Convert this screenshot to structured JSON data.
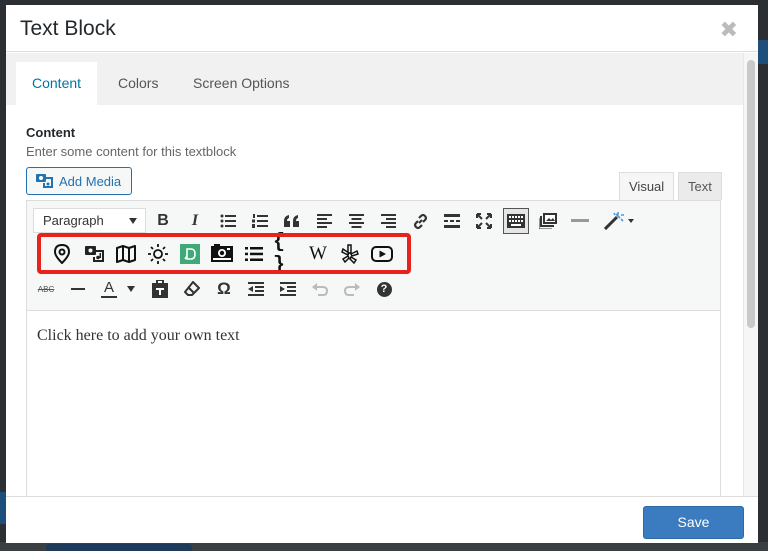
{
  "modal": {
    "title": "Text Block",
    "close_glyph": "✖"
  },
  "tabs": [
    {
      "label": "Content",
      "active": true
    },
    {
      "label": "Colors",
      "active": false
    },
    {
      "label": "Screen Options",
      "active": false
    }
  ],
  "content": {
    "label": "Content",
    "description": "Enter some content for this textblock"
  },
  "add_media": {
    "label": "Add Media",
    "icon": "media-icon"
  },
  "editor_modes": {
    "visual": "Visual",
    "text": "Text"
  },
  "toolbar": {
    "format_value": "Paragraph",
    "row1_icons": [
      "bold-icon",
      "italic-icon",
      "bullet-list-icon",
      "numbered-list-icon",
      "blockquote-icon",
      "align-left-icon",
      "align-center-icon",
      "align-right-icon",
      "link-icon",
      "read-more-icon",
      "fullscreen-icon",
      "toolbar-toggle-icon",
      "gallery-icon",
      "horizontal-rule-icon",
      "magic-wand-icon"
    ],
    "row1_text": {
      "bold": "B",
      "italic": "I"
    },
    "plugin_icons": [
      "map-pin-icon",
      "media-icon",
      "map-icon",
      "sun-icon",
      "plugin-d-icon",
      "photo-gallery-icon",
      "list-icon",
      "code-braces-icon",
      "wikipedia-icon",
      "yelp-icon",
      "youtube-icon"
    ],
    "plugin_text": {
      "braces": "{ }",
      "wiki": "W"
    },
    "row3_icons": [
      "strikethrough-icon",
      "horizontal-line-icon",
      "text-color-icon",
      "paste-text-icon",
      "clear-format-icon",
      "omega-icon",
      "outdent-icon",
      "indent-icon",
      "undo-icon",
      "redo-icon",
      "help-icon"
    ],
    "row3_text": {
      "strike": "ABC",
      "color": "A",
      "omega": "Ω",
      "help": "?"
    }
  },
  "editor": {
    "placeholder_text": "Click here to add your own text"
  },
  "footer": {
    "save_label": "Save"
  },
  "colors": {
    "accent": "#0073aa",
    "highlight": "#e8231d",
    "save": "#3b7bc0",
    "plugin_green": "#3daa78"
  }
}
